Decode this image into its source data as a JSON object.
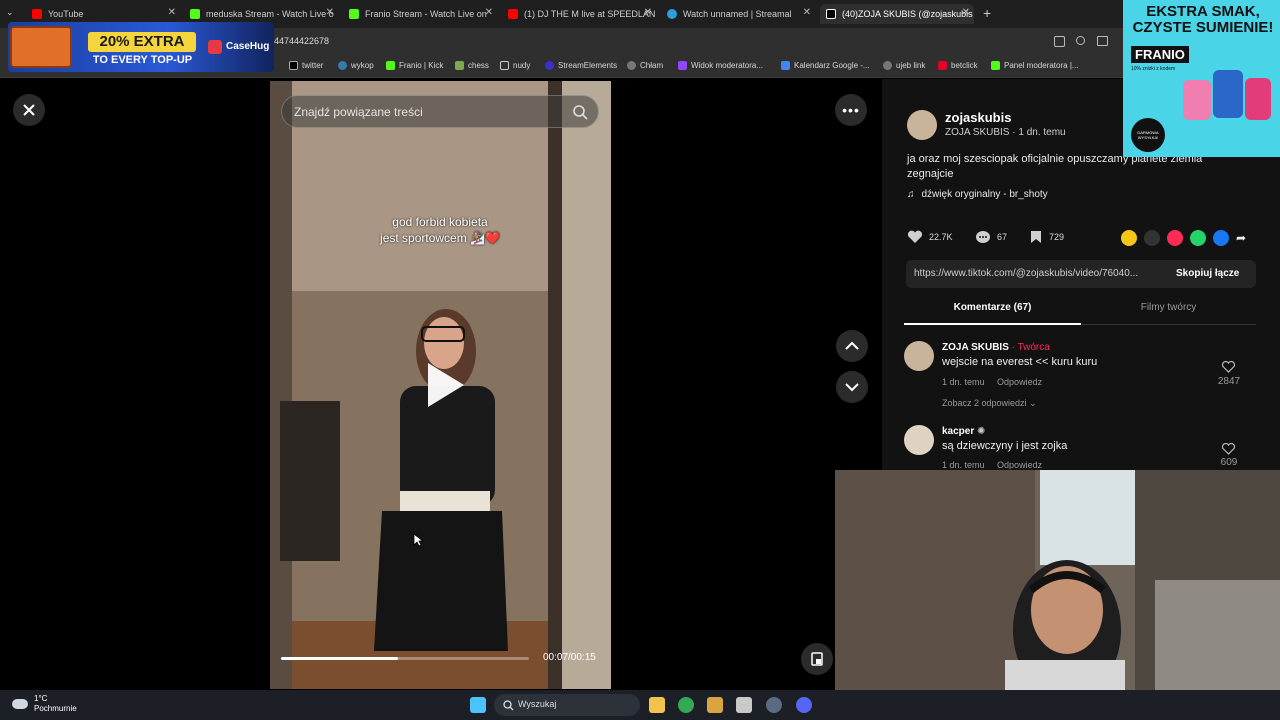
{
  "browser": {
    "tabs": [
      {
        "title": "YouTube",
        "color": "#ff0000"
      },
      {
        "title": "meduska Stream - Watch Live o",
        "color": "#53fc18"
      },
      {
        "title": "Franio Stream - Watch Live on",
        "color": "#53fc18"
      },
      {
        "title": "(1) DJ THE M live at SPEEDLAN",
        "color": "#ff0000"
      },
      {
        "title": "Watch unnamed | Streamal",
        "color": "#2d9cdb"
      },
      {
        "title": "(40)ZOJA SKUBIS (@zojaskubis",
        "color": "#ffffff"
      }
    ],
    "url": "44744422678",
    "bookmarks": [
      {
        "label": "twitter"
      },
      {
        "label": "wykop"
      },
      {
        "label": "Franio | Kick"
      },
      {
        "label": "chess"
      },
      {
        "label": "nudy"
      },
      {
        "label": "StreamElements"
      },
      {
        "label": "Chłam"
      },
      {
        "label": "Widok moderatora..."
      },
      {
        "label": "Kalendarz Google -..."
      },
      {
        "label": "ujeb link"
      },
      {
        "label": "betclick"
      },
      {
        "label": "Panel moderatora |..."
      }
    ]
  },
  "ads": {
    "casehug": {
      "headline": "20% EXTRA",
      "sub": "TO EVERY TOP-UP",
      "brand": "CaseHug"
    },
    "franio": {
      "line1": "EKSTRA SMAK,",
      "line2": "CZYSTE SUMIENIE!",
      "brand": "FRANIO",
      "tag": "10% zniżki z kodem",
      "badge": "DARMOWA WYSYŁKA!"
    }
  },
  "video": {
    "search_placeholder": "Znajdź powiązane treści",
    "caption_line1": "god forbid kobieta",
    "caption_line2": "jest sportowcem 🏂❤️",
    "time": "00:07/00:15",
    "progress": 0.47
  },
  "post": {
    "username": "zojaskubis",
    "display": "ZOJA SKUBIS · 1 dn. temu",
    "desc_line1": "ja oraz moj szesciopak oficjalnie opuszczamy planete ziemia",
    "desc_line2": "zegnajcie",
    "sound": "dźwięk oryginalny - br_shoty",
    "likes": "22.7K",
    "comments": "67",
    "saves": "729",
    "link": "https://www.tiktok.com/@zojaskubis/video/76040...",
    "copy_label": "Skopiuj łącze",
    "tab_comments": "Komentarze (67)",
    "tab_videos": "Filmy twórcy"
  },
  "comments": [
    {
      "author": "ZOJA SKUBIS",
      "badge": "· Twórca",
      "text": "wejscie na everest << kuru kuru",
      "time": "1 dn. temu",
      "reply": "Odpowiedz",
      "likes": "2847",
      "more": "Zobacz 2 odpowiedzi"
    },
    {
      "author": "kacper",
      "badge": "",
      "text": "są dziewczyny i jest zojka",
      "time": "1 dn. temu",
      "reply": "Odpowiedz",
      "likes": "609",
      "more": ""
    }
  ],
  "taskbar": {
    "temp": "1°C",
    "weather": "Pochmurnie",
    "search": "Wyszukaj"
  },
  "colors": {
    "accent_red": "#fe2c55",
    "tab_bar": "#1f1f1f",
    "panel": "#121212"
  }
}
